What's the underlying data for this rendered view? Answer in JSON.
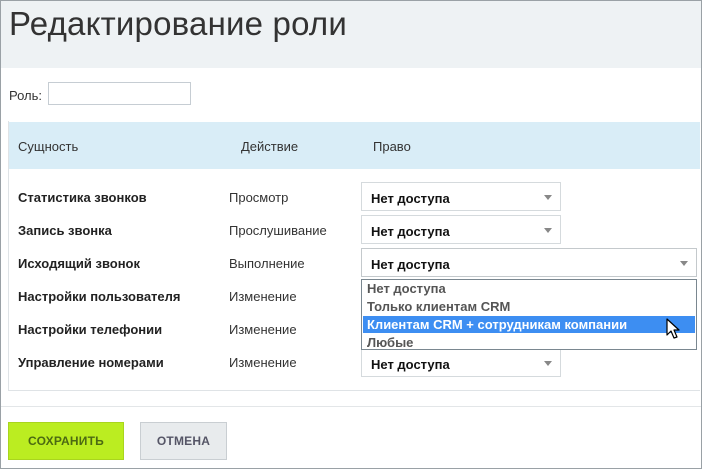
{
  "page": {
    "title": "Редактирование роли"
  },
  "role": {
    "label": "Роль:",
    "value": ""
  },
  "table": {
    "headers": {
      "entity": "Сущность",
      "action": "Действие",
      "right": "Право"
    },
    "rows": [
      {
        "entity": "Статистика звонков",
        "action": "Просмотр",
        "right": "Нет доступа"
      },
      {
        "entity": "Запись звонка",
        "action": "Прослушивание",
        "right": "Нет доступа"
      },
      {
        "entity": "Исходящий звонок",
        "action": "Выполнение",
        "right": "Нет доступа"
      },
      {
        "entity": "Настройки пользователя",
        "action": "Изменение",
        "right": ""
      },
      {
        "entity": "Настройки телефонии",
        "action": "Изменение",
        "right": ""
      },
      {
        "entity": "Управление номерами",
        "action": "Изменение",
        "right": "Нет доступа"
      }
    ]
  },
  "dropdown": {
    "options": [
      "Нет доступа",
      "Только клиентам CRM",
      "Клиентам CRM + сотрудникам компании",
      "Любые"
    ],
    "highlighted_index": 2,
    "highlight_color": "#3d8ef2"
  },
  "buttons": {
    "save": "Сохранить",
    "cancel": "Отмена"
  },
  "colors": {
    "header_bg": "#eef2f4",
    "table_header_bg": "#d9edf7",
    "save_bg": "#bbed21"
  }
}
